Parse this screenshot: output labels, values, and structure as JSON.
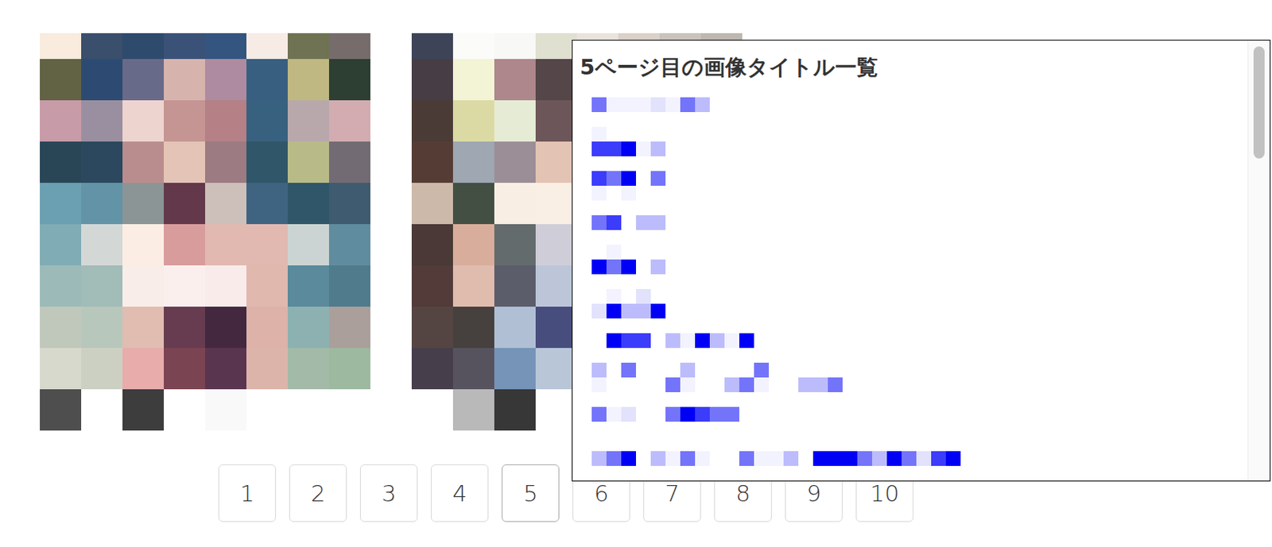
{
  "popup": {
    "title": "5ページ目の画像タイトル一覧"
  },
  "pagination": {
    "pages": [
      {
        "label": "1",
        "selected": false
      },
      {
        "label": "2",
        "selected": false
      },
      {
        "label": "3",
        "selected": false
      },
      {
        "label": "4",
        "selected": false
      },
      {
        "label": "5",
        "selected": true
      },
      {
        "label": "6",
        "selected": false
      },
      {
        "label": "7",
        "selected": false
      },
      {
        "label": "8",
        "selected": false
      },
      {
        "label": "9",
        "selected": false
      },
      {
        "label": "10",
        "selected": false
      }
    ]
  }
}
